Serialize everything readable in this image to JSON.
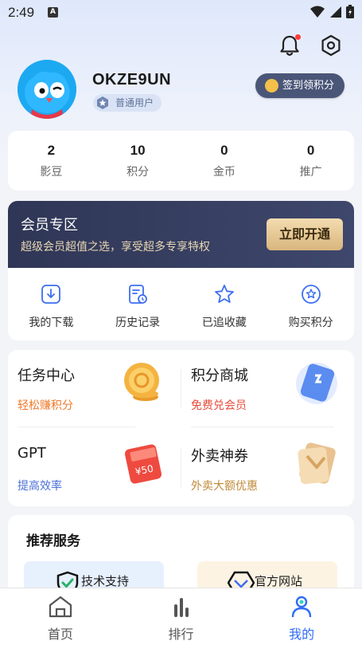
{
  "status_bar": {
    "time": "2:49",
    "app_badge": "A"
  },
  "profile": {
    "username": "OKZE9UN",
    "user_tag": "普通用户",
    "signin_label": "签到领积分"
  },
  "stats": [
    {
      "value": "2",
      "label": "影豆"
    },
    {
      "value": "10",
      "label": "积分"
    },
    {
      "value": "0",
      "label": "金币"
    },
    {
      "value": "0",
      "label": "推广"
    }
  ],
  "vip": {
    "title": "会员专区",
    "subtitle": "超级会员超值之选，享受超多专享特权",
    "button": "立即开通"
  },
  "quick_actions": [
    {
      "label": "我的下载",
      "icon": "download-icon"
    },
    {
      "label": "历史记录",
      "icon": "history-icon"
    },
    {
      "label": "已追收藏",
      "icon": "star-icon"
    },
    {
      "label": "购买积分",
      "icon": "buy-points-icon"
    }
  ],
  "tasks": [
    {
      "title": "任务中心",
      "subtitle": "轻松赚积分",
      "subtitle_color": "#f07a2a",
      "icon": "coins-icon"
    },
    {
      "title": "积分商城",
      "subtitle": "免费兑会员",
      "subtitle_color": "#e84b3c",
      "icon": "card-icon"
    },
    {
      "title": "GPT",
      "subtitle": "提高效率",
      "subtitle_color": "#4a6fd8",
      "icon": "ticket-icon"
    },
    {
      "title": "外卖神券",
      "subtitle": "外卖大额优惠",
      "subtitle_color": "#c08a3a",
      "icon": "coupon-icon"
    }
  ],
  "ticket_text": "¥50",
  "services": {
    "title": "推荐服务",
    "items": [
      {
        "label": "技术支持",
        "icon": "shield-check-icon"
      },
      {
        "label": "官方网站",
        "icon": "website-icon"
      }
    ]
  },
  "tabs": [
    {
      "label": "首页",
      "icon": "home-icon",
      "active": false
    },
    {
      "label": "排行",
      "icon": "ranking-icon",
      "active": false
    },
    {
      "label": "我的",
      "icon": "profile-icon",
      "active": true
    }
  ],
  "colors": {
    "accent": "#2f6df6",
    "vip_bg": "#353d60",
    "vip_gold": "#e2c089"
  }
}
